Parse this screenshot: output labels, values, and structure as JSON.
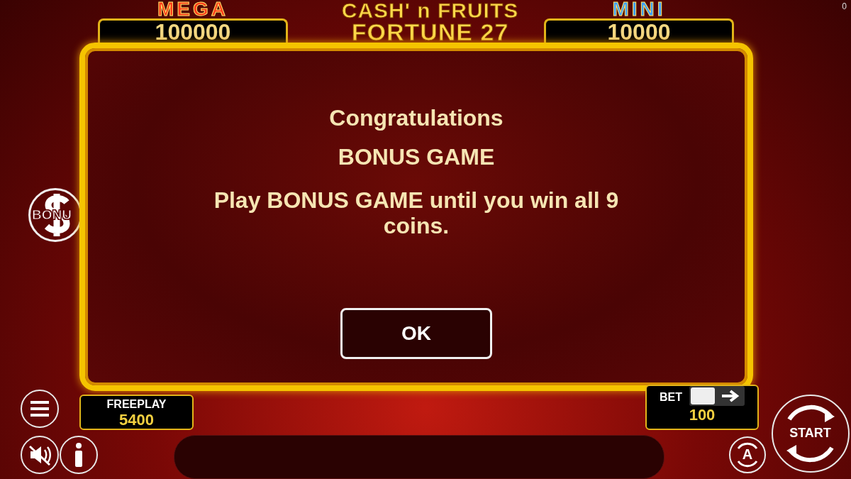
{
  "corner_counter": "0",
  "jackpots": [
    {
      "kind": "mega",
      "title": "MEGA",
      "value": "100000"
    },
    {
      "kind": "logo",
      "line1": "CASH' n FRUITS",
      "line2": "FORTUNE 27"
    },
    {
      "kind": "mini",
      "title": "MINI",
      "value": "10000"
    }
  ],
  "bonus_badge": {
    "label": "BONU"
  },
  "dialog": {
    "title": "Congratulations",
    "subtitle": "BONUS GAME",
    "message": "Play BONUS GAME until you win all 9 coins.",
    "button": "OK"
  },
  "freeplay": {
    "label": "FREEPLAY",
    "value": "5400"
  },
  "bet": {
    "label": "BET",
    "value": "100"
  },
  "start_button": "START",
  "auto_button": "A"
}
